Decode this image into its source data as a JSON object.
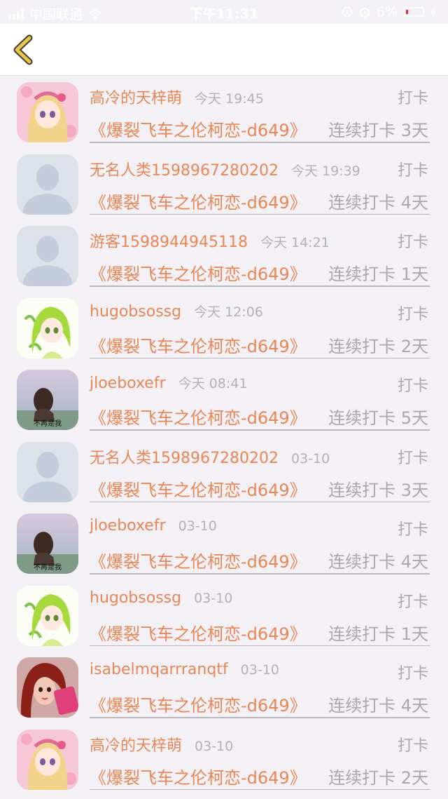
{
  "status_bar": {
    "carrier": "中国联通",
    "time": "下午11:31",
    "battery": "6%"
  },
  "nav": {
    "back_icon": "chevron-left-icon",
    "accent": "#e8c547"
  },
  "colors": {
    "orange": "#e98655",
    "gray": "#aaa7ad"
  },
  "rows": [
    {
      "avatar": "anime-girl-pink",
      "name": "高冷的天梓萌",
      "time": "今天 19:45",
      "action": "打卡",
      "book": "《爆裂飞车之伦柯恋-d649》",
      "streak": "连续打卡 3天"
    },
    {
      "avatar": "default-person",
      "name": "无名人类1598967280202",
      "time": "今天 19:39",
      "action": "打卡",
      "book": "《爆裂飞车之伦柯恋-d649》",
      "streak": "连续打卡 4天"
    },
    {
      "avatar": "default-person",
      "name": "游客1598944945118",
      "time": "今天 14:21",
      "action": "打卡",
      "book": "《爆裂飞车之伦柯恋-d649》",
      "streak": "连续打卡 1天"
    },
    {
      "avatar": "anime-girl-green",
      "name": "hugobsossg",
      "time": "今天 12:06",
      "action": "打卡",
      "book": "《爆裂飞车之伦柯恋-d649》",
      "streak": "连续打卡 2天"
    },
    {
      "avatar": "photo-girl-sky",
      "avatar_caption": "不再是我",
      "name": "jloeboxefr",
      "time": "今天 08:41",
      "action": "打卡",
      "book": "《爆裂飞车之伦柯恋-d649》",
      "streak": "连续打卡 5天"
    },
    {
      "avatar": "default-person",
      "name": "无名人类1598967280202",
      "time": "03-10",
      "action": "打卡",
      "book": "《爆裂飞车之伦柯恋-d649》",
      "streak": "连续打卡 3天"
    },
    {
      "avatar": "photo-girl-sky",
      "avatar_caption": "不再是我",
      "name": "jloeboxefr",
      "time": "03-10",
      "action": "打卡",
      "book": "《爆裂飞车之伦柯恋-d649》",
      "streak": "连续打卡 4天"
    },
    {
      "avatar": "anime-girl-green",
      "name": "hugobsossg",
      "time": "03-10",
      "action": "打卡",
      "book": "《爆裂飞车之伦柯恋-d649》",
      "streak": "连续打卡 1天"
    },
    {
      "avatar": "photo-girl-red",
      "name": "isabelmqarrranqtf",
      "time": "03-10",
      "action": "打卡",
      "book": "《爆裂飞车之伦柯恋-d649》",
      "streak": "连续打卡 4天"
    },
    {
      "avatar": "anime-girl-pink",
      "name": "高冷的天梓萌",
      "time": "03-10",
      "action": "打卡",
      "book": "《爆裂飞车之伦柯恋-d649》",
      "streak": "连续打卡 2天"
    }
  ]
}
